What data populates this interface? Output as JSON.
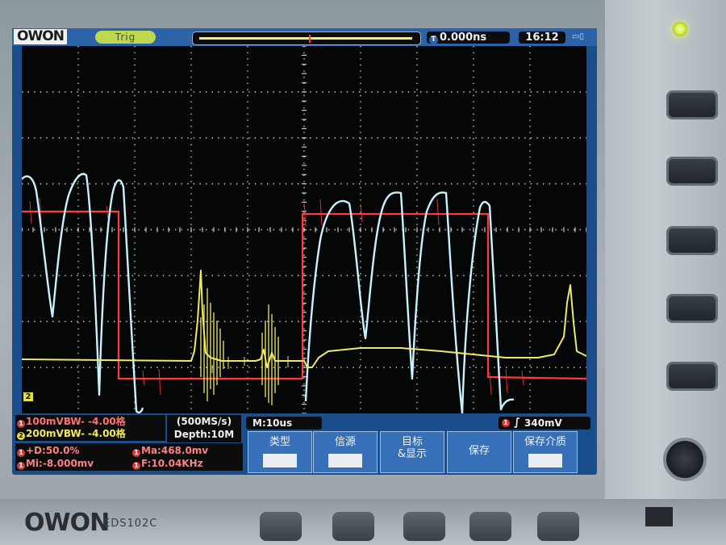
{
  "device": {
    "brand_logo": "OWON",
    "brand_bottom": "OWON",
    "model": "EDS102C"
  },
  "top_bar": {
    "trigger_status": "Trig",
    "delay": "0.000ns",
    "delay_icon": "T",
    "clock": "16:12"
  },
  "plot": {
    "ch2_marker": "2",
    "trigger_marker": "T"
  },
  "channels": [
    {
      "index": "1",
      "label": "100mVBW- -4.00格",
      "color": "#ff4040"
    },
    {
      "index": "2",
      "label": "200mVBW- -4.00格",
      "color": "#e8e03a"
    }
  ],
  "acquisition": {
    "sample_rate": "(500MS/s)",
    "depth": "Depth:10M"
  },
  "timebase": {
    "label": "M:10us"
  },
  "trigger": {
    "source": "1",
    "edge_icon": "rising-edge-icon",
    "level": "340mV"
  },
  "measurements": [
    {
      "icon": "1",
      "text": "+D:50.0%"
    },
    {
      "icon": "1",
      "text": "Ma:468.0mv"
    },
    {
      "icon": "1",
      "text": "Mi:-8.000mv"
    },
    {
      "icon": "1",
      "text": "F:10.04KHz"
    }
  ],
  "menu": [
    {
      "label": "类型",
      "value": ""
    },
    {
      "label": "信源",
      "value": ""
    },
    {
      "label": "目标\n&显示",
      "value": ""
    },
    {
      "label": "保存",
      "value": ""
    },
    {
      "label": "保存介质",
      "value": ""
    }
  ],
  "colors": {
    "ch1_trace": "#ff3b3b",
    "ch2_trace": "#f0ea60",
    "math_trace": "#c8f2ff",
    "grid": "#d8d8d8",
    "screen_bg": "#050606",
    "ui_blue": "#2c62a8"
  }
}
